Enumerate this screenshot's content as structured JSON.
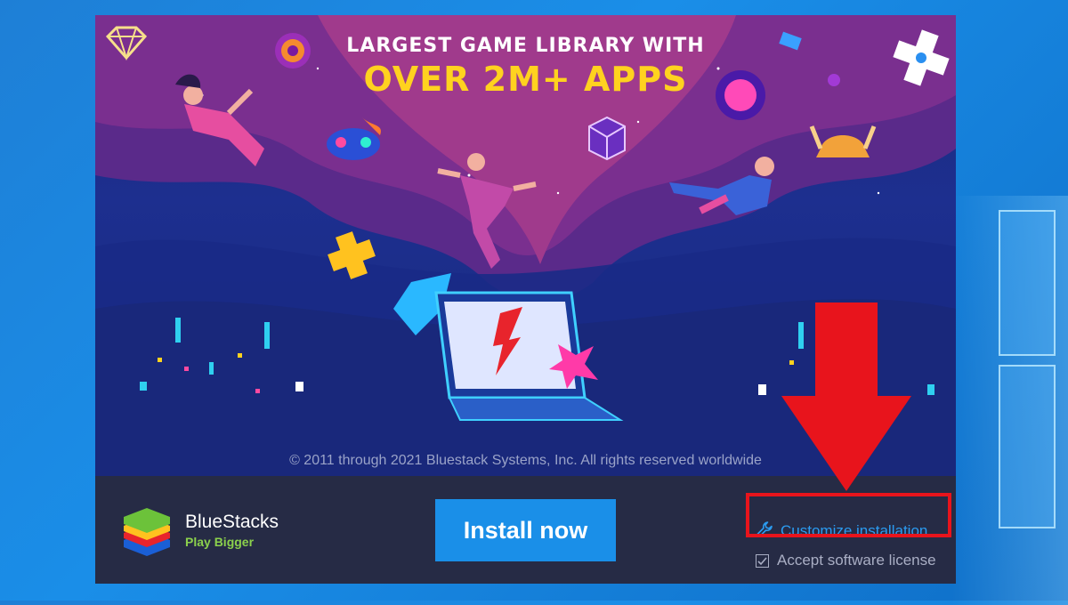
{
  "banner": {
    "headline_line1": "LARGEST GAME LIBRARY WITH",
    "headline_line2": "OVER 2M+ APPS",
    "copyright": "© 2011 through 2021 Bluestack Systems, Inc. All rights reserved worldwide"
  },
  "footer": {
    "brand_name": "BlueStacks",
    "brand_tagline": "Play Bigger",
    "install_label": "Install now",
    "customize_label": "Customize installation",
    "customize_icon": "wrench-icon",
    "license_label": "Accept software license",
    "license_checked": true
  },
  "annotation": {
    "highlight_color": "#e8141c"
  },
  "colors": {
    "install_button": "#1a8fe8",
    "link": "#2b9bf0",
    "tagline": "#8bd14c",
    "headline_accent": "#ffd21f"
  }
}
